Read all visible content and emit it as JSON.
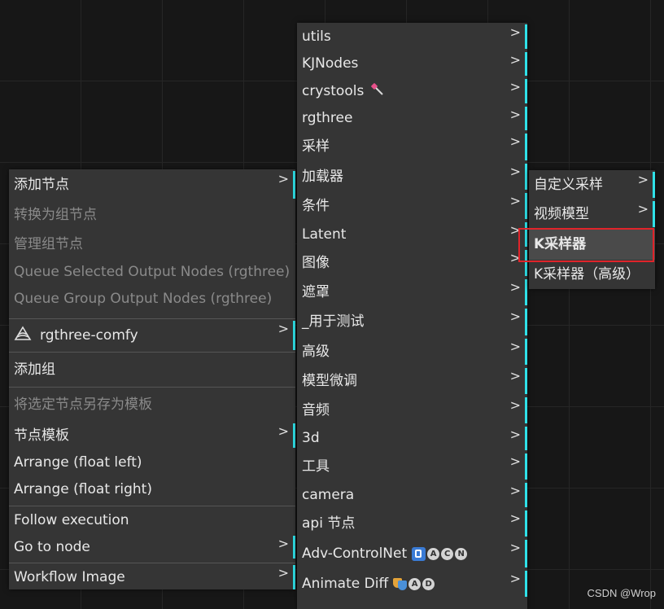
{
  "context_menu": {
    "items": [
      {
        "label": "添加节点",
        "enabled": true,
        "submenu": true
      },
      {
        "label": "转换为组节点",
        "enabled": false,
        "submenu": false
      },
      {
        "label": "管理组节点",
        "enabled": false,
        "submenu": false
      },
      {
        "label": "Queue Selected Output Nodes (rgthree)",
        "enabled": false,
        "submenu": false
      },
      {
        "label": "Queue Group Output Nodes (rgthree)",
        "enabled": false,
        "submenu": false
      },
      {
        "label": "rgthree-comfy",
        "enabled": true,
        "submenu": true,
        "icon": "rgthree-logo-icon"
      },
      {
        "label": "添加组",
        "enabled": true,
        "submenu": false
      },
      {
        "label": "将选定节点另存为模板",
        "enabled": false,
        "submenu": false
      },
      {
        "label": "节点模板",
        "enabled": true,
        "submenu": true
      },
      {
        "label": "Arrange (float left)",
        "enabled": true,
        "submenu": false
      },
      {
        "label": "Arrange (float right)",
        "enabled": true,
        "submenu": false
      },
      {
        "label": "Follow execution",
        "enabled": true,
        "submenu": false
      },
      {
        "label": "Go to node",
        "enabled": true,
        "submenu": true
      },
      {
        "label": "Workflow Image",
        "enabled": true,
        "submenu": true
      }
    ]
  },
  "node_menu": {
    "items": [
      {
        "label": "utils"
      },
      {
        "label": "KJNodes"
      },
      {
        "label": "crystools",
        "icon": "screwdriver-icon"
      },
      {
        "label": "rgthree"
      },
      {
        "label": "采样"
      },
      {
        "label": "加载器"
      },
      {
        "label": "条件"
      },
      {
        "label": "Latent"
      },
      {
        "label": "图像"
      },
      {
        "label": "遮罩"
      },
      {
        "label": "_用于测试"
      },
      {
        "label": "高级"
      },
      {
        "label": "模型微调"
      },
      {
        "label": "音频"
      },
      {
        "label": "3d"
      },
      {
        "label": "工具"
      },
      {
        "label": "camera"
      },
      {
        "label": "api 节点"
      },
      {
        "label": "Adv-ControlNet",
        "badges": [
          "A",
          "C",
          "N"
        ]
      },
      {
        "label": "Animate Diff",
        "badges": [
          "A",
          "D"
        ]
      }
    ]
  },
  "sampling_menu": {
    "items": [
      {
        "label": "自定义采样",
        "submenu": true
      },
      {
        "label": "视频模型",
        "submenu": true
      },
      {
        "label": "K采样器",
        "submenu": false,
        "selected": true
      },
      {
        "label": "K采样器（高级）",
        "submenu": false
      }
    ]
  },
  "arrow_glyph": ">",
  "watermark": "CSDN @Wrop",
  "colors": {
    "accent_bar": "#2fe1e8",
    "highlight_border": "#e0242a",
    "menu_bg": "#353535",
    "disabled_text": "#8a8a8a"
  }
}
